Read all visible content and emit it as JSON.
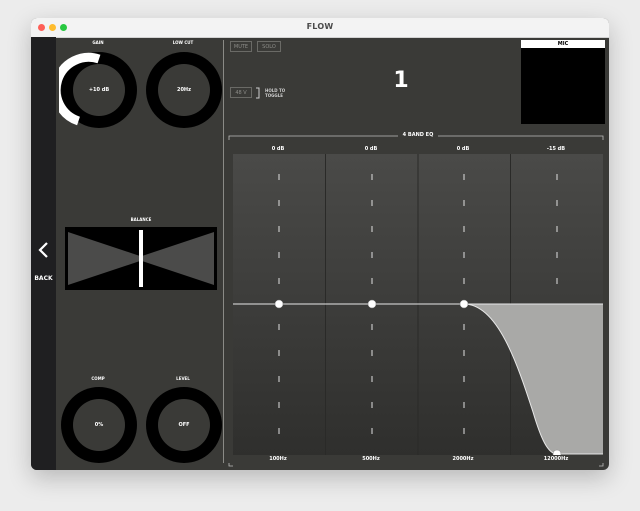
{
  "window": {
    "title": "FLOW"
  },
  "back": {
    "label": "BACK"
  },
  "knobs": {
    "gain": {
      "label": "GAIN",
      "value": "+10 dB"
    },
    "low_cut": {
      "label": "LOW CUT",
      "value": "20Hz"
    },
    "comp": {
      "label": "COMP",
      "value": "0%"
    },
    "level": {
      "label": "LEVEL",
      "value": "OFF"
    }
  },
  "balance": {
    "label": "BALANCE"
  },
  "channel": {
    "mute_label": "MUTE",
    "solo_label": "SOLO",
    "phantom_label": "48 V",
    "hold_line1": "HOLD TO",
    "hold_line2": "TOGGLE",
    "number": "1"
  },
  "mic": {
    "label": "MIC"
  },
  "eq": {
    "title": "4 BAND EQ",
    "bands": [
      {
        "gain": "0 dB",
        "freq": "100Hz"
      },
      {
        "gain": "0 dB",
        "freq": "500Hz"
      },
      {
        "gain": "0 dB",
        "freq": "2000Hz"
      },
      {
        "gain": "-15 dB",
        "freq": "12000Hz"
      }
    ]
  },
  "colors": {
    "panel": "#3a3a37",
    "rail": "#1f1f21",
    "knob_ring": "#000000",
    "gain_arc": "#ffffff",
    "eq_fill": "#a9a9a7"
  }
}
